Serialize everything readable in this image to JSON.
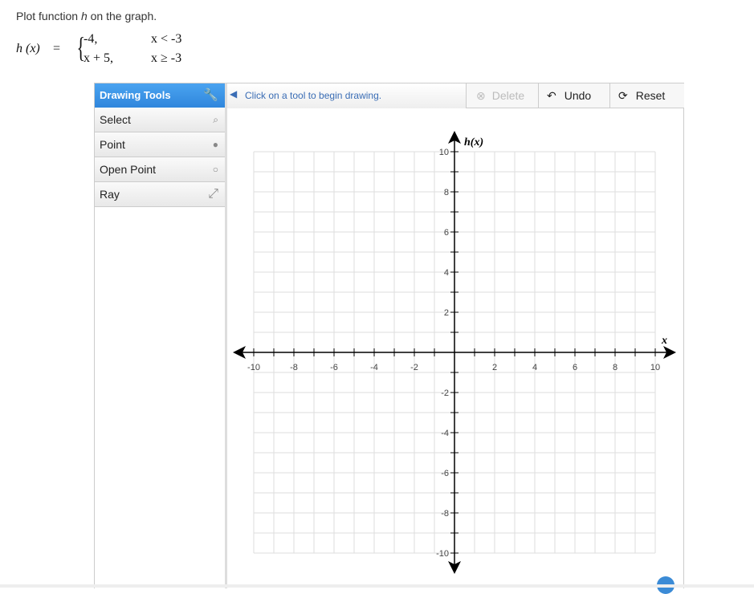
{
  "question": {
    "prefix": "Plot function ",
    "var": "h",
    "suffix": " on the graph."
  },
  "equation": {
    "lhs": "h (x)",
    "eq": "=",
    "piece1_expr": "-4,",
    "piece1_cond": "x < -3",
    "piece2_expr": "x + 5,",
    "piece2_cond": "x ≥ -3"
  },
  "tools": {
    "header": "Drawing Tools",
    "items": [
      {
        "label": "Select",
        "icon": "cursor-icon"
      },
      {
        "label": "Point",
        "icon": "point-icon"
      },
      {
        "label": "Open Point",
        "icon": "open-point-icon"
      },
      {
        "label": "Ray",
        "icon": "ray-icon"
      }
    ]
  },
  "toolbar": {
    "message": "Click on a tool to begin drawing.",
    "delete": "Delete",
    "undo": "Undo",
    "reset": "Reset"
  },
  "graph": {
    "xlabel": "x",
    "ylabel": "h(x)",
    "xmin": -10,
    "xmax": 10,
    "ymin": -10,
    "ymax": 10,
    "grid_step": 1,
    "label_step": 2
  }
}
